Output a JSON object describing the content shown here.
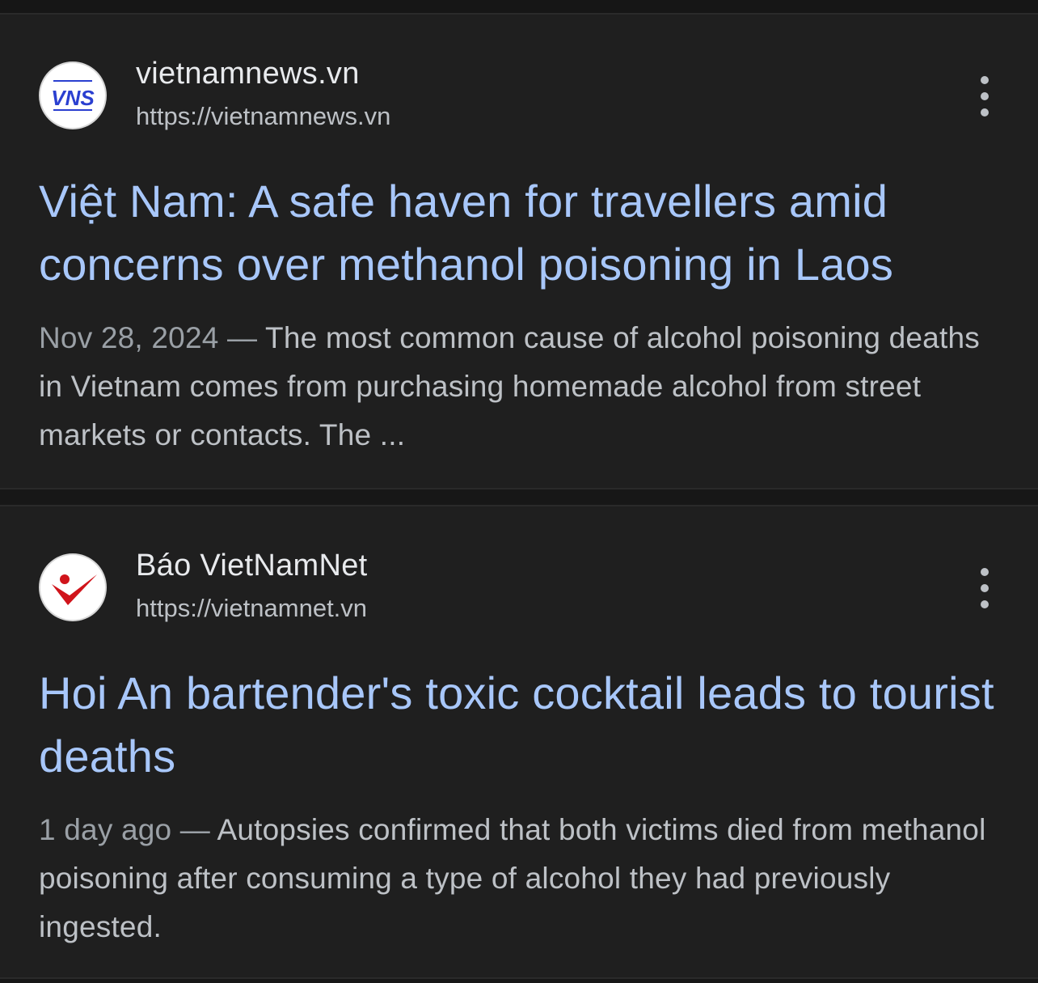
{
  "results": [
    {
      "site_name": "vietnamnews.vn",
      "url": "https://vietnamnews.vn",
      "favicon_text": "VNS",
      "title": "Việt Nam: A safe haven for travellers amid concerns over methanol poisoning in Laos",
      "date": "Nov 28, 2024",
      "separator": " — ",
      "snippet": "The most common cause of alcohol poisoning deaths in Vietnam comes from purchasing homemade alcohol from street markets or contacts. The ..."
    },
    {
      "site_name": "Báo VietNamNet",
      "url": "https://vietnamnet.vn",
      "title": "Hoi An bartender's toxic cocktail leads to tourist deaths",
      "date": "1 day ago",
      "separator": " — ",
      "snippet": "Autopsies confirmed that both victims died from methanol poisoning after consuming a type of alcohol they had previously ingested."
    }
  ],
  "colors": {
    "background": "#171717",
    "card": "#1f1f1f",
    "title_link": "#a8c7fa",
    "site_name": "#e8eaed",
    "secondary_text": "#bdc1c6",
    "date_text": "#9aa0a6",
    "vns_logo_blue": "#2a3fd0",
    "vietnamnet_red": "#d0141b"
  },
  "icons": [
    "vns-favicon-icon",
    "vietnamnet-favicon-icon",
    "more-vert-icon"
  ]
}
